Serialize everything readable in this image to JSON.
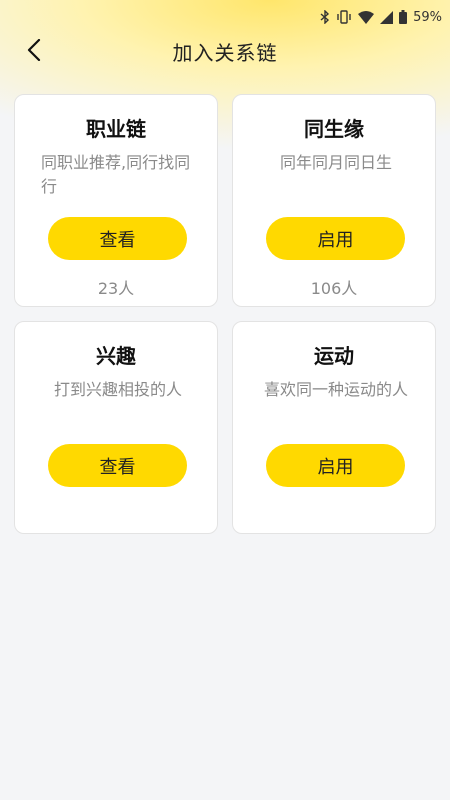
{
  "status_bar": {
    "battery_percent": "59%",
    "icons": [
      "bluetooth-icon",
      "vibrate-icon",
      "wifi-icon",
      "signal-icon",
      "battery-icon"
    ]
  },
  "header": {
    "title": "加入关系链",
    "back_icon": "back-arrow-icon"
  },
  "colors": {
    "accent": "#ffd900",
    "background": "#f4f5f7",
    "card": "#ffffff",
    "muted_text": "#8a8a8a"
  },
  "cards": [
    {
      "title": "职业链",
      "desc": "同职业推荐,同行找同行",
      "button": "查看",
      "count": "23人"
    },
    {
      "title": "同生缘",
      "desc": "同年同月同日生",
      "button": "启用",
      "count": "106人"
    },
    {
      "title": "兴趣",
      "desc": "打到兴趣相投的人",
      "button": "查看",
      "count": ""
    },
    {
      "title": "运动",
      "desc": "喜欢同一种运动的人",
      "button": "启用",
      "count": ""
    }
  ]
}
